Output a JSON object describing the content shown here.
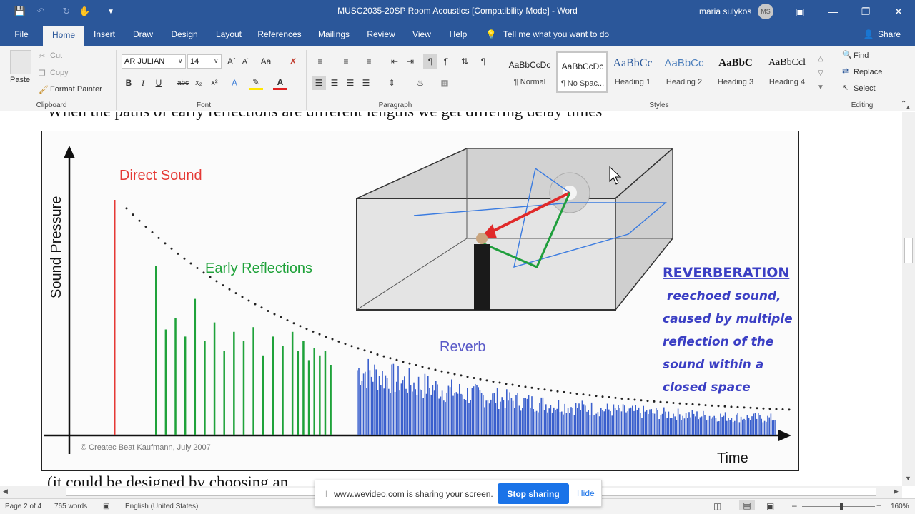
{
  "titlebar": {
    "title": "MUSC2035-20SP Room Acoustics [Compatibility Mode]  -  Word",
    "user": "maria sulykos",
    "avatar_initials": "MS"
  },
  "tabs": [
    "File",
    "Home",
    "Insert",
    "Draw",
    "Design",
    "Layout",
    "References",
    "Mailings",
    "Review",
    "View",
    "Help"
  ],
  "tell_me": "Tell me what you want to do",
  "share_label": "Share",
  "clipboard": {
    "paste": "Paste",
    "cut": "Cut",
    "copy": "Copy",
    "format_painter": "Format Painter",
    "group": "Clipboard"
  },
  "font": {
    "name": "AR JULIAN",
    "size": "14",
    "group": "Font"
  },
  "paragraph": {
    "group": "Paragraph"
  },
  "styles": {
    "group": "Styles",
    "items": [
      {
        "preview": "AaBbCcDc",
        "name": "¶ Normal"
      },
      {
        "preview": "AaBbCcDc",
        "name": "¶ No Spac..."
      },
      {
        "preview": "AaBbCc",
        "name": "Heading 1"
      },
      {
        "preview": "AaBbCc",
        "name": "Heading 2"
      },
      {
        "preview": "AaBbC",
        "name": "Heading 3"
      },
      {
        "preview": "AaBbCcl",
        "name": "Heading 4"
      }
    ]
  },
  "editing": {
    "find": "Find",
    "replace": "Replace",
    "select": "Select",
    "group": "Editing"
  },
  "document": {
    "line_top": "When the paths of early reflections are different lengths we get differing delay times",
    "line_bottom": "(it could be designed by choosing an"
  },
  "figure": {
    "y_label": "Sound Pressure",
    "x_label": "Time",
    "direct_sound": "Direct Sound",
    "early_reflections": "Early Reflections",
    "reverb": "Reverb",
    "copyright": "© Createc Beat Kaufmann, July 2007",
    "reverberation_title": "REVERBERATION",
    "reverberation_lines": [
      "reechoed sound,",
      "caused by multiple",
      "reflection of the",
      "sound within a",
      "closed space"
    ],
    "colors": {
      "direct": "#e53935",
      "early": "#1fa23a",
      "reverb": "#3a5fcd",
      "blue_text": "#3b3fc4"
    },
    "early_heights": [
      0.72,
      0.45,
      0.5,
      0.42,
      0.58,
      0.4,
      0.48,
      0.36,
      0.44,
      0.4,
      0.46,
      0.34,
      0.42,
      0.38,
      0.44,
      0.36,
      0.4,
      0.32,
      0.37,
      0.34,
      0.36,
      0.3
    ]
  },
  "sharing": {
    "message": "www.wevideo.com is sharing your screen.",
    "stop": "Stop sharing",
    "hide": "Hide"
  },
  "status": {
    "page": "Page 2 of 4",
    "words": "765 words",
    "language": "English (United States)",
    "zoom": "160%"
  }
}
